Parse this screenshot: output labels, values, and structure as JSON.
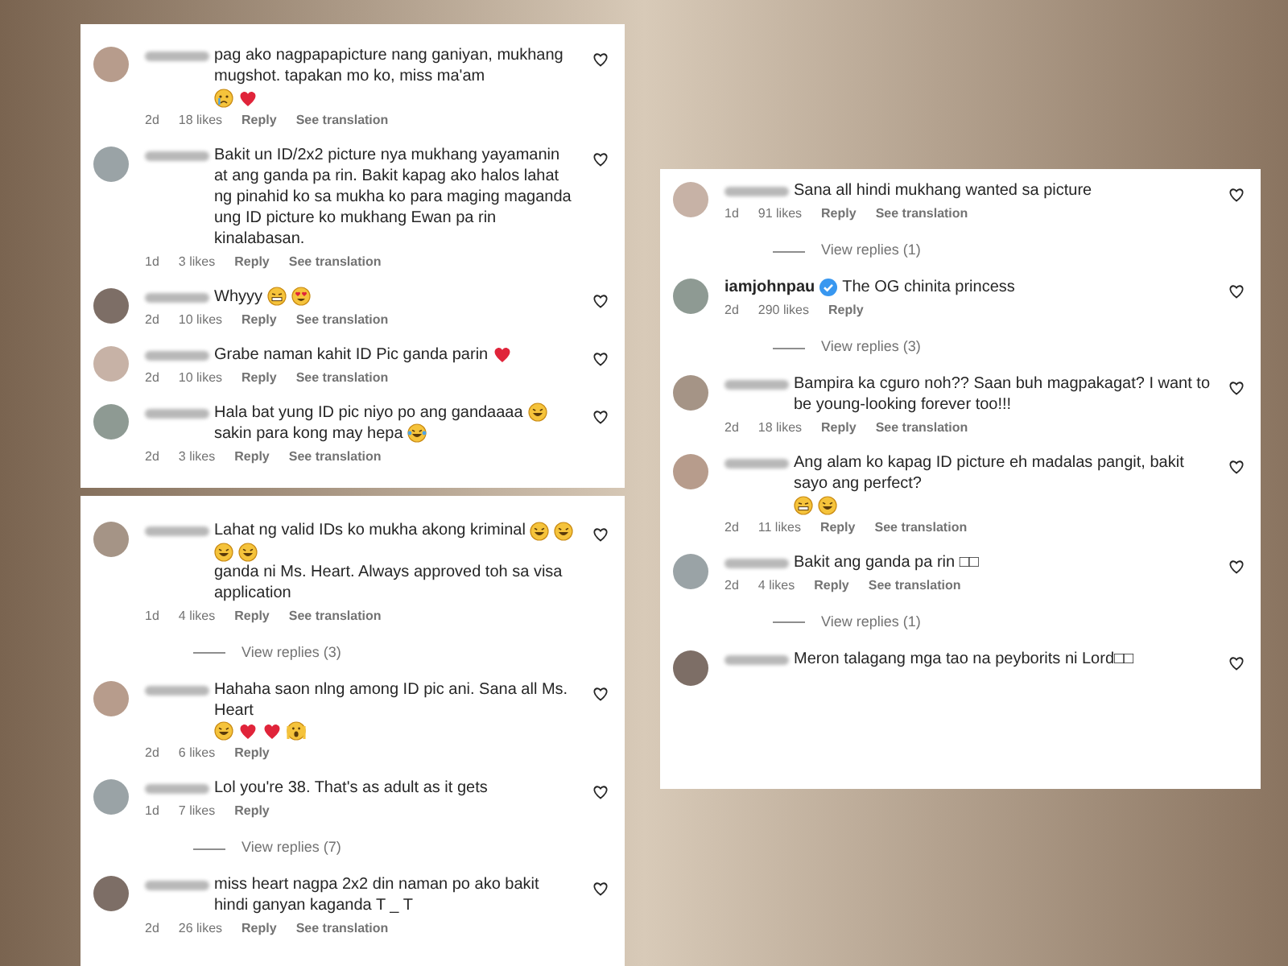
{
  "panels": [
    {
      "items": [
        {
          "kind": "comment",
          "verified": false,
          "parts": [
            {
              "text": "pag ako nagpapapicture nang ganiyan, mukhang mugshot. tapakan mo ko, miss ma'am"
            },
            {
              "kind": "cry"
            },
            {
              "kind": "heart"
            }
          ],
          "meta": [
            "2d",
            "18 likes",
            "Reply",
            "See translation"
          ]
        },
        {
          "kind": "comment",
          "verified": false,
          "parts": [
            {
              "text": "Bakit un ID/2x2 picture nya mukhang yayamanin at ang ganda pa rin. Bakit kapag ako halos lahat ng pinahid ko sa mukha ko para maging maganda ung ID picture ko mukhang Ewan pa rin kinalabasan."
            }
          ],
          "meta": [
            "1d",
            "3 likes",
            "Reply",
            "See translation"
          ]
        },
        {
          "kind": "comment",
          "verified": false,
          "parts": [
            {
              "text": "Whyyy"
            },
            {
              "kind": "grimace"
            },
            {
              "kind": "heart-eyes"
            }
          ],
          "meta": [
            "2d",
            "10 likes",
            "Reply",
            "See translation"
          ]
        },
        {
          "kind": "comment",
          "verified": false,
          "parts": [
            {
              "text": "Grabe naman kahit ID Pic ganda parin"
            },
            {
              "kind": "heart"
            }
          ],
          "meta": [
            "2d",
            "10 likes",
            "Reply",
            "See translation"
          ]
        },
        {
          "kind": "comment",
          "verified": false,
          "parts": [
            {
              "text": "Hala bat yung ID pic niyo po ang gandaaaa"
            },
            {
              "kind": "laugh"
            },
            {
              "text": "sakin para kong may hepa"
            },
            {
              "kind": "laugh-cry"
            }
          ],
          "meta": [
            "2d",
            "3 likes",
            "Reply",
            "See translation"
          ]
        }
      ]
    },
    {
      "items": [
        {
          "kind": "comment",
          "verified": false,
          "parts": [
            {
              "text": "Lahat ng valid IDs ko mukha akong kriminal"
            },
            {
              "kind": "laugh"
            },
            {
              "kind": "laugh"
            },
            {
              "kind": "laugh"
            },
            {
              "kind": "laugh"
            },
            {
              "text": "ganda ni Ms. Heart. Always approved toh sa visa application"
            }
          ],
          "meta": [
            "1d",
            "4 likes",
            "Reply",
            "See translation"
          ]
        },
        {
          "kind": "replies",
          "text": "View replies (3)"
        },
        {
          "kind": "comment",
          "verified": false,
          "parts": [
            {
              "text": "Hahaha saon nlng among ID pic ani. Sana all Ms. Heart"
            },
            {
              "kind": "laugh"
            },
            {
              "kind": "heart"
            },
            {
              "kind": "heart"
            },
            {
              "kind": "scream"
            }
          ],
          "meta": [
            "2d",
            "6 likes",
            "Reply"
          ]
        },
        {
          "kind": "comment",
          "verified": false,
          "parts": [
            {
              "text": "Lol you're 38. That's as adult as it gets"
            }
          ],
          "meta": [
            "1d",
            "7 likes",
            "Reply"
          ]
        },
        {
          "kind": "replies",
          "text": "View replies (7)"
        },
        {
          "kind": "comment",
          "verified": false,
          "parts": [
            {
              "text": "miss heart nagpa 2x2 din naman po ako bakit hindi ganyan kaganda T _ T"
            }
          ],
          "meta": [
            "2d",
            "26 likes",
            "Reply",
            "See translation"
          ]
        }
      ]
    },
    {
      "items": [
        {
          "kind": "comment",
          "verified": false,
          "parts": [
            {
              "text": "Sana all hindi mukhang wanted sa picture"
            }
          ],
          "meta": [
            "1d",
            "91 likes",
            "Reply",
            "See translation"
          ]
        },
        {
          "kind": "replies",
          "text": "View replies (1)"
        },
        {
          "kind": "comment",
          "username": "iamjohnpau",
          "verified": true,
          "parts": [
            {
              "text": "The OG chinita princess"
            }
          ],
          "meta": [
            "2d",
            "290 likes",
            "Reply"
          ]
        },
        {
          "kind": "replies",
          "text": "View replies (3)"
        },
        {
          "kind": "comment",
          "verified": false,
          "parts": [
            {
              "text": "Bampira ka cguro noh?? Saan buh magpakagat? I want to be young-looking forever too!!!"
            }
          ],
          "meta": [
            "2d",
            "18 likes",
            "Reply",
            "See translation"
          ]
        },
        {
          "kind": "comment",
          "verified": false,
          "parts": [
            {
              "text": "Ang alam ko kapag ID picture eh madalas pangit, bakit sayo ang perfect?"
            },
            {
              "kind": "grimace"
            },
            {
              "kind": "laugh"
            }
          ],
          "meta": [
            "2d",
            "11 likes",
            "Reply",
            "See translation"
          ]
        },
        {
          "kind": "comment",
          "verified": false,
          "parts": [
            {
              "text": "Bakit ang ganda pa rin □□"
            }
          ],
          "meta": [
            "2d",
            "4 likes",
            "Reply",
            "See translation"
          ]
        },
        {
          "kind": "replies",
          "text": "View replies (1)"
        },
        {
          "kind": "comment",
          "verified": false,
          "parts": [
            {
              "text": "Meron talagang mga tao na peyborits ni Lord□□"
            }
          ]
        }
      ]
    }
  ]
}
